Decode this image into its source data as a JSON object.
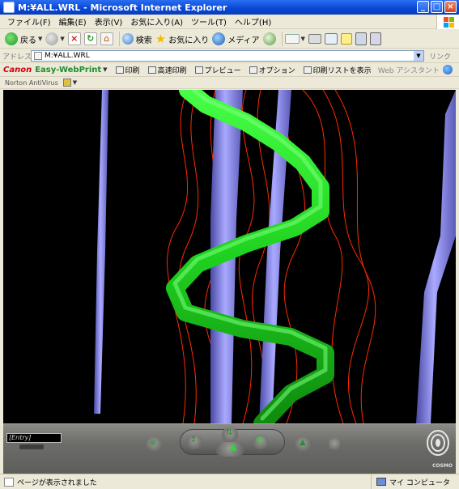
{
  "window": {
    "title": "M:¥ALL.WRL - Microsoft Internet Explorer",
    "min_label": "_",
    "max_label": "□",
    "close_label": "×"
  },
  "menubar": {
    "items": [
      "ファイル(F)",
      "編集(E)",
      "表示(V)",
      "お気に入り(A)",
      "ツール(T)",
      "ヘルプ(H)"
    ]
  },
  "toolbar": {
    "back_label": "戻る",
    "search_label": "検索",
    "favorites_label": "お気に入り",
    "media_label": "メディア"
  },
  "address": {
    "label": "アドレス(D)",
    "value": "M:¥ALL.WRL",
    "links_label": "リンク"
  },
  "canonbar": {
    "brand": "Canon",
    "product": "Easy-WebPrint",
    "print_label": "印刷",
    "hq_print_label": "高速印刷",
    "preview_label": "プレビュー",
    "options_label": "オプション",
    "print_list_label": "印刷リストを表示",
    "web_assistant_label": "Web アシスタント"
  },
  "norton": {
    "label": "Norton AntiVirus"
  },
  "cosmo": {
    "entry_value": "[Entry]",
    "logo_text": "COSMO"
  },
  "status": {
    "text": "ページが表示されました",
    "zone_label": "マイ コンピュータ"
  },
  "colors": {
    "helix": "#1fd21f",
    "tubes": "#7a7ae6",
    "threads": "#ff2a00"
  }
}
